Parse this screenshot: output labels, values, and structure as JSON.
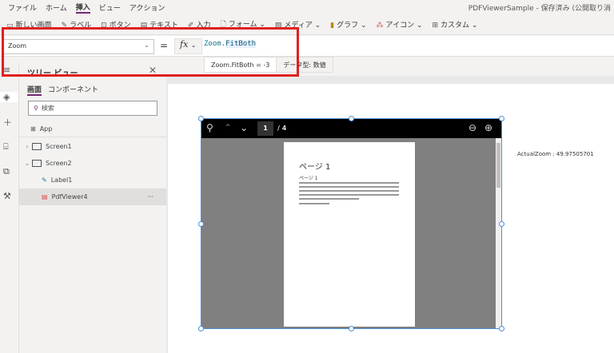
{
  "menu": {
    "items": [
      "ファイル",
      "ホーム",
      "挿入",
      "ビュー",
      "アクション"
    ],
    "active": "挿入"
  },
  "title": "PDFViewerSample - 保存済み (公開取り消",
  "ribbon": {
    "items": [
      "新しい画面",
      "ラベル",
      "ボタン",
      "テキスト",
      "入力",
      "フォーム",
      "メディア",
      "グラフ",
      "アイコン",
      "カスタム"
    ]
  },
  "formula": {
    "property": "Zoom",
    "equals": "=",
    "fx": "fx",
    "expr_obj": "Zoom",
    "expr_dot": ".",
    "expr_member": "FitBoth",
    "hint_expr": "Zoom.FitBoth  =  -3",
    "hint_type": "データ型: 数値"
  },
  "tree": {
    "title": "ツリー ビュー",
    "tabs": [
      "画面",
      "コンポーネント"
    ],
    "search_placeholder": "検索",
    "nodes": [
      {
        "label": "App"
      },
      {
        "label": "Screen1"
      },
      {
        "label": "Screen2"
      },
      {
        "label": "Label1"
      },
      {
        "label": "PdfViewer4",
        "more": "···"
      }
    ]
  },
  "viewer": {
    "page": "1",
    "total": "/ 4",
    "page_heading": "ページ 1",
    "page_subheading": "ページ 1"
  },
  "label": {
    "text": "ActualZoom : 49.97505701"
  },
  "colors": {
    "accent": "#742774",
    "highlight": "#e02020",
    "selection": "#4a90d9"
  }
}
